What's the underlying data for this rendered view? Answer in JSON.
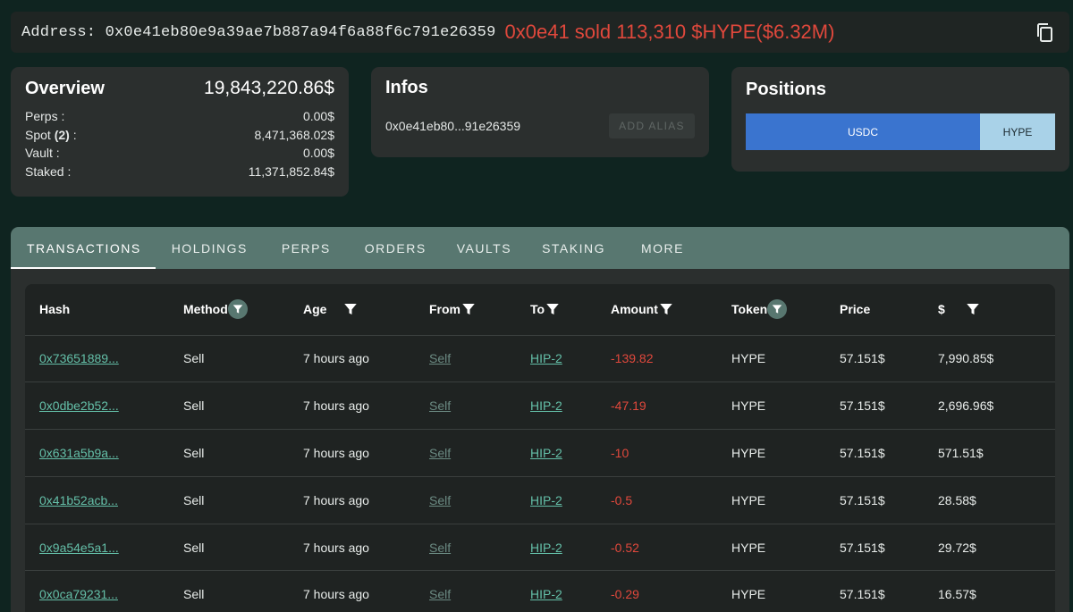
{
  "address_bar": {
    "label": "Address: 0x0e41eb80e9a39ae7b887a94f6a88f6c791e26359",
    "headline": "0x0e41 sold 113,310 $HYPE($6.32M)",
    "headline_color": "#e0483c"
  },
  "overview": {
    "title": "Overview",
    "total": "19,843,220.86$",
    "rows": [
      {
        "label": "Perps :",
        "value": "0.00$"
      },
      {
        "label_prefix": "Spot ",
        "label_bold": "(2)",
        "label_suffix": " :",
        "value": "8,471,368.02$"
      },
      {
        "label": "Vault :",
        "value": "0.00$"
      },
      {
        "label": "Staked :",
        "value": "11,371,852.84$"
      }
    ]
  },
  "infos": {
    "title": "Infos",
    "short_address": "0x0e41eb80...91e26359",
    "alias_button": "ADD ALIAS"
  },
  "positions": {
    "title": "Positions",
    "segments": [
      {
        "label": "USDC",
        "share": 0.757,
        "color": "#3a74cf"
      },
      {
        "label": "HYPE",
        "share": 0.243,
        "color": "#a9d2e8"
      }
    ]
  },
  "tabs": [
    "TRANSACTIONS",
    "HOLDINGS",
    "PERPS",
    "ORDERS",
    "VAULTS",
    "STAKING",
    "MORE"
  ],
  "active_tab": "TRANSACTIONS",
  "table": {
    "columns": [
      "Hash",
      "Method",
      "Age",
      "From",
      "To",
      "Amount",
      "Token",
      "Price",
      "$"
    ],
    "rows": [
      {
        "hash": "0x73651889...",
        "method": "Sell",
        "age": "7 hours ago",
        "from": "Self",
        "to": "HIP-2",
        "amount": "-139.82",
        "token": "HYPE",
        "price": "57.151$",
        "usd": "7,990.85$"
      },
      {
        "hash": "0x0dbe2b52...",
        "method": "Sell",
        "age": "7 hours ago",
        "from": "Self",
        "to": "HIP-2",
        "amount": "-47.19",
        "token": "HYPE",
        "price": "57.151$",
        "usd": "2,696.96$"
      },
      {
        "hash": "0x631a5b9a...",
        "method": "Sell",
        "age": "7 hours ago",
        "from": "Self",
        "to": "HIP-2",
        "amount": "-10",
        "token": "HYPE",
        "price": "57.151$",
        "usd": "571.51$"
      },
      {
        "hash": "0x41b52acb...",
        "method": "Sell",
        "age": "7 hours ago",
        "from": "Self",
        "to": "HIP-2",
        "amount": "-0.5",
        "token": "HYPE",
        "price": "57.151$",
        "usd": "28.58$"
      },
      {
        "hash": "0x9a54e5a1...",
        "method": "Sell",
        "age": "7 hours ago",
        "from": "Self",
        "to": "HIP-2",
        "amount": "-0.52",
        "token": "HYPE",
        "price": "57.151$",
        "usd": "29.72$"
      },
      {
        "hash": "0x0ca79231...",
        "method": "Sell",
        "age": "7 hours ago",
        "from": "Self",
        "to": "HIP-2",
        "amount": "-0.29",
        "token": "HYPE",
        "price": "57.151$",
        "usd": "16.57$"
      }
    ]
  },
  "icons": {
    "copy": "copy-icon",
    "filter": "filter-icon"
  }
}
